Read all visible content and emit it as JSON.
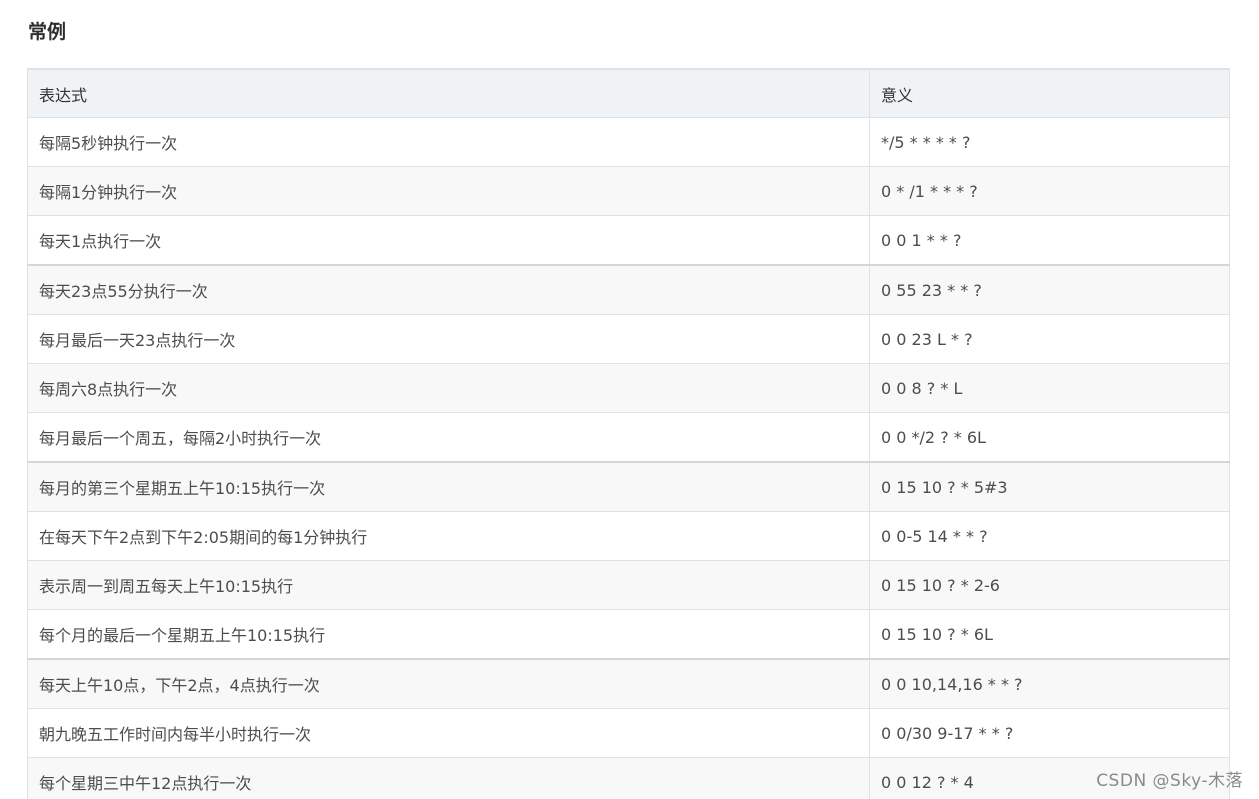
{
  "section": {
    "title": "常例"
  },
  "table": {
    "headers": [
      "表达式",
      "意义"
    ],
    "rows": [
      [
        "每隔5秒钟执行一次",
        "*/5 * * * * ?"
      ],
      [
        "每隔1分钟执行一次",
        "0 * /1 * * * ?"
      ],
      [
        "每天1点执行一次",
        "0 0 1 * * ?"
      ],
      [
        "每天23点55分执行一次",
        "0 55 23 * * ?"
      ],
      [
        "每月最后一天23点执行一次",
        "0 0 23 L * ?"
      ],
      [
        "每周六8点执行一次",
        "0 0 8 ? * L"
      ],
      [
        "每月最后一个周五，每隔2小时执行一次",
        "0 0 */2 ? * 6L"
      ],
      [
        "每月的第三个星期五上午10:15执行一次",
        "0 15 10 ? * 5#3"
      ],
      [
        "在每天下午2点到下午2:05期间的每1分钟执行",
        "0 0-5 14 * * ?"
      ],
      [
        "表示周一到周五每天上午10:15执行",
        "0 15 10 ? * 2-6"
      ],
      [
        "每个月的最后一个星期五上午10:15执行",
        "0 15 10 ? * 6L"
      ],
      [
        "每天上午10点，下午2点，4点执行一次",
        "0 0 10,14,16 * * ?"
      ],
      [
        "朝九晚五工作时间内每半小时执行一次",
        "0 0/30 9-17 * * ?"
      ],
      [
        "每个星期三中午12点执行一次",
        "0 0 12 ? * 4"
      ]
    ]
  },
  "watermark": {
    "text": "CSDN @Sky-木落"
  }
}
